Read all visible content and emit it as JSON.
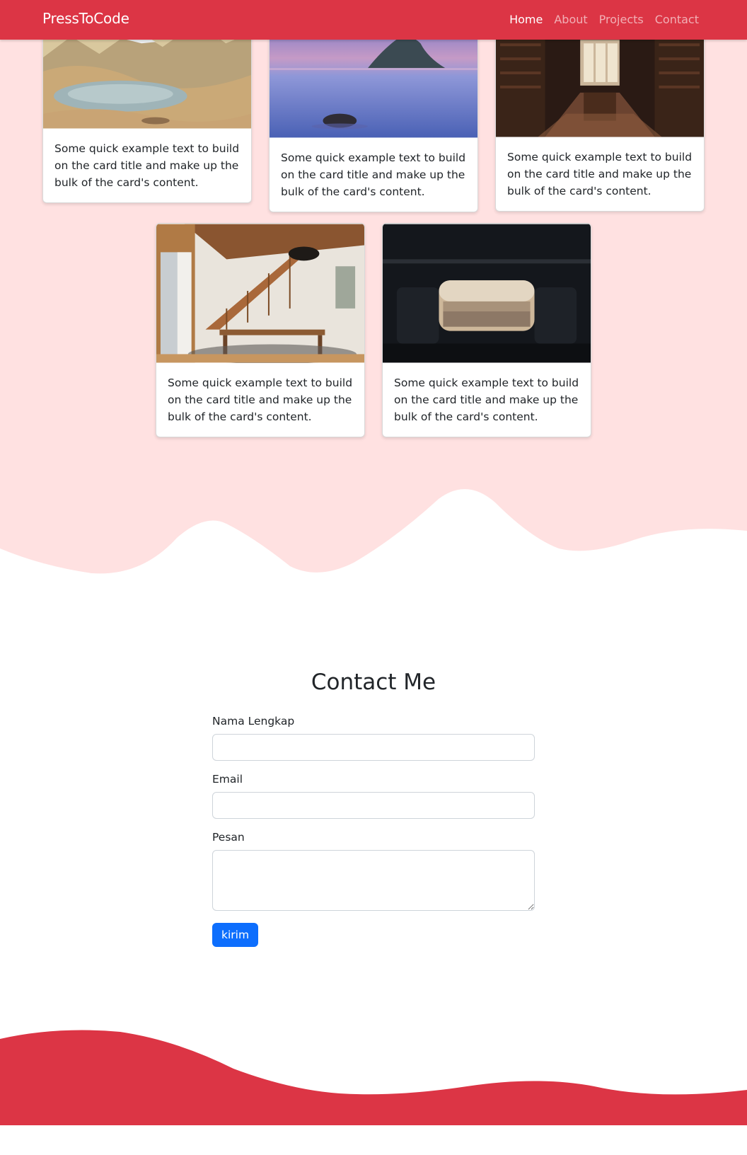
{
  "navbar": {
    "brand": "PressToCode",
    "links": [
      {
        "label": "Home",
        "active": true
      },
      {
        "label": "About",
        "active": false
      },
      {
        "label": "Projects",
        "active": false
      },
      {
        "label": "Contact",
        "active": false
      }
    ]
  },
  "projects": {
    "cards": [
      {
        "text": "Some quick example text to build on the card title and make up the bulk of the card's content.",
        "image": "mountain-lake-painting"
      },
      {
        "text": "Some quick example text to build on the card title and make up the bulk of the card's content.",
        "image": "sea-rock-dusk"
      },
      {
        "text": "Some quick example text to build on the card title and make up the bulk of the card's content.",
        "image": "library-hall"
      },
      {
        "text": "Some quick example text to build on the card title and make up the bulk of the card's content.",
        "image": "dining-room-stairs"
      },
      {
        "text": "Some quick example text to build on the card title and make up the bulk of the card's content.",
        "image": "train-window-city"
      }
    ]
  },
  "contact": {
    "title": "Contact Me",
    "fields": {
      "name_label": "Nama Lengkap",
      "email_label": "Email",
      "message_label": "Pesan",
      "name_value": "",
      "email_value": "",
      "message_value": ""
    },
    "submit_label": "kirim"
  },
  "colors": {
    "navbar": "#dc3545",
    "projects_bg": "#ffe1e1",
    "button": "#0d6efd",
    "footer_wave": "#dc3545"
  }
}
